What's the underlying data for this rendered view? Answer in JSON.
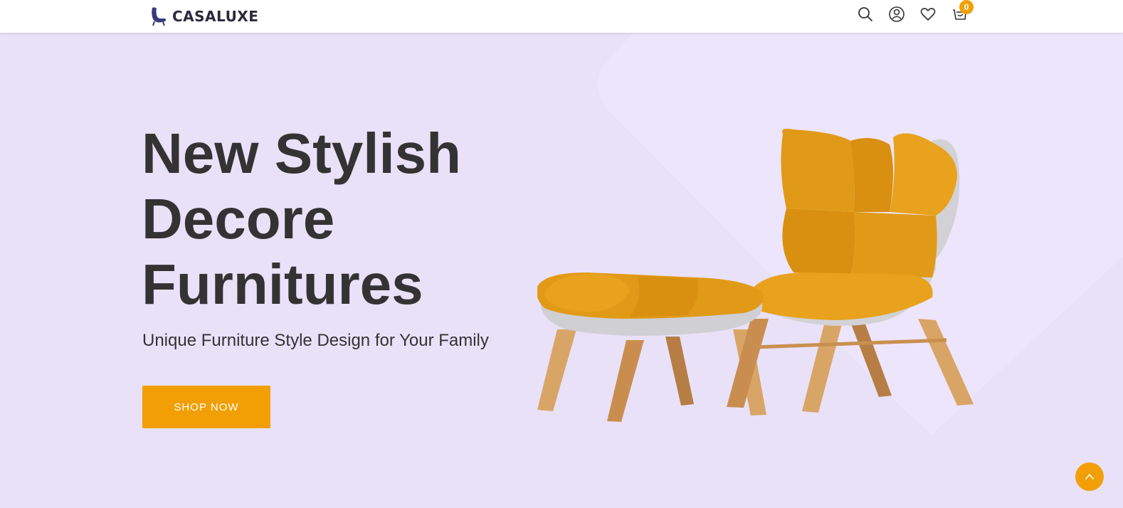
{
  "brand": {
    "name": "CASALUXE"
  },
  "header": {
    "icons": [
      "search-icon",
      "user-icon",
      "heart-icon",
      "cart-icon"
    ],
    "cart_count": "0"
  },
  "hero": {
    "title_lines": [
      "New Stylish",
      "Decore",
      "Furnitures"
    ],
    "subtitle": "Unique Furniture Style Design for Your Family",
    "cta_label": "SHOP NOW"
  },
  "colors": {
    "accent": "#f29f05",
    "background": "#e9e1f8",
    "text": "#333333",
    "logo": "#3a3a7a"
  },
  "scroll_top": {
    "icon": "chevron-up-icon"
  }
}
